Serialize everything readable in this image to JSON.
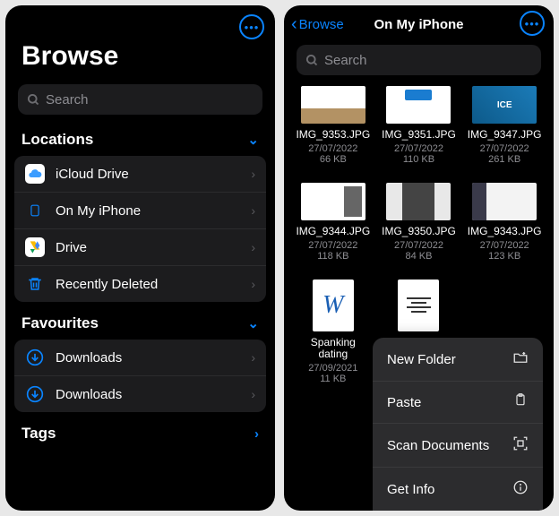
{
  "left": {
    "title": "Browse",
    "search_placeholder": "Search",
    "sections": {
      "locations_label": "Locations",
      "favourites_label": "Favourites",
      "tags_label": "Tags"
    },
    "locations": [
      {
        "label": "iCloud Drive"
      },
      {
        "label": "On My iPhone"
      },
      {
        "label": "Drive"
      },
      {
        "label": "Recently Deleted"
      }
    ],
    "favourites": [
      {
        "label": "Downloads"
      },
      {
        "label": "Downloads"
      }
    ]
  },
  "right": {
    "back_label": "Browse",
    "title": "On My iPhone",
    "search_placeholder": "Search",
    "files": [
      {
        "name": "IMG_9353.JPG",
        "date": "27/07/2022",
        "size": "66 KB"
      },
      {
        "name": "IMG_9351.JPG",
        "date": "27/07/2022",
        "size": "110 KB"
      },
      {
        "name": "IMG_9347.JPG",
        "date": "27/07/2022",
        "size": "261 KB"
      },
      {
        "name": "IMG_9344.JPG",
        "date": "27/07/2022",
        "size": "118 KB"
      },
      {
        "name": "IMG_9350.JPG",
        "date": "27/07/2022",
        "size": "84 KB"
      },
      {
        "name": "IMG_9343.JPG",
        "date": "27/07/2022",
        "size": "123 KB"
      },
      {
        "name": "Spanking dating",
        "date": "27/09/2021",
        "size": "11 KB"
      }
    ],
    "context_menu": [
      {
        "label": "New Folder",
        "icon": "new-folder-icon"
      },
      {
        "label": "Paste",
        "icon": "paste-icon"
      },
      {
        "label": "Scan Documents",
        "icon": "scan-icon"
      },
      {
        "label": "Get Info",
        "icon": "info-icon"
      }
    ]
  }
}
